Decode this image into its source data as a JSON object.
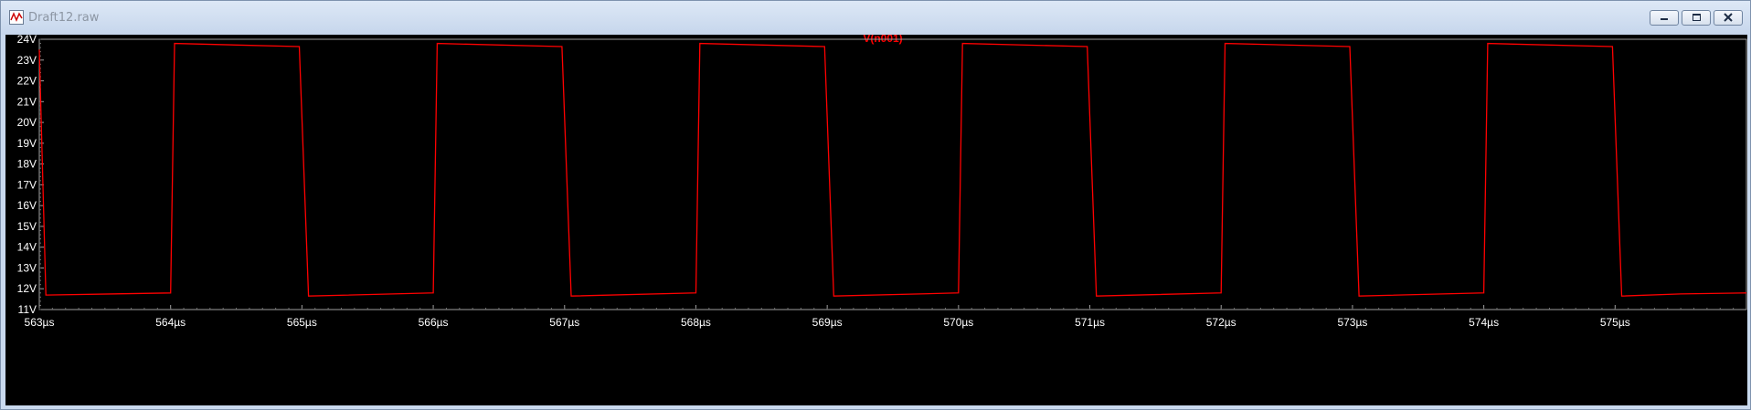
{
  "window": {
    "title": "Draft12.raw"
  },
  "chart_data": {
    "type": "line",
    "title": "V(n001)",
    "xlabel": "",
    "ylabel": "",
    "x_unit": "µs",
    "y_unit": "V",
    "xlim": [
      563,
      576.0
    ],
    "ylim": [
      11,
      24
    ],
    "x_ticks": [
      "563µs",
      "564µs",
      "565µs",
      "566µs",
      "567µs",
      "568µs",
      "569µs",
      "570µs",
      "571µs",
      "572µs",
      "573µs",
      "574µs",
      "575µs"
    ],
    "y_ticks": [
      "11V",
      "12V",
      "13V",
      "14V",
      "15V",
      "16V",
      "17V",
      "18V",
      "19V",
      "20V",
      "21V",
      "22V",
      "23V",
      "24V"
    ],
    "grid": false,
    "series": [
      {
        "name": "V(n001)",
        "color": "#ff0000",
        "x": [
          563.0,
          563.05,
          564.0,
          564.03,
          564.98,
          565.05,
          566.0,
          566.03,
          566.98,
          567.05,
          568.0,
          568.03,
          568.98,
          569.05,
          570.0,
          570.03,
          570.98,
          571.05,
          572.0,
          572.03,
          572.98,
          573.05,
          574.0,
          574.03,
          574.98,
          575.05,
          575.5,
          576.0
        ],
        "values": [
          23.5,
          11.7,
          11.8,
          23.8,
          23.65,
          11.65,
          11.8,
          23.8,
          23.65,
          11.65,
          11.8,
          23.8,
          23.65,
          11.65,
          11.8,
          23.8,
          23.65,
          11.65,
          11.8,
          23.8,
          23.65,
          11.65,
          11.8,
          23.8,
          23.65,
          11.65,
          11.75,
          11.8
        ]
      }
    ]
  }
}
